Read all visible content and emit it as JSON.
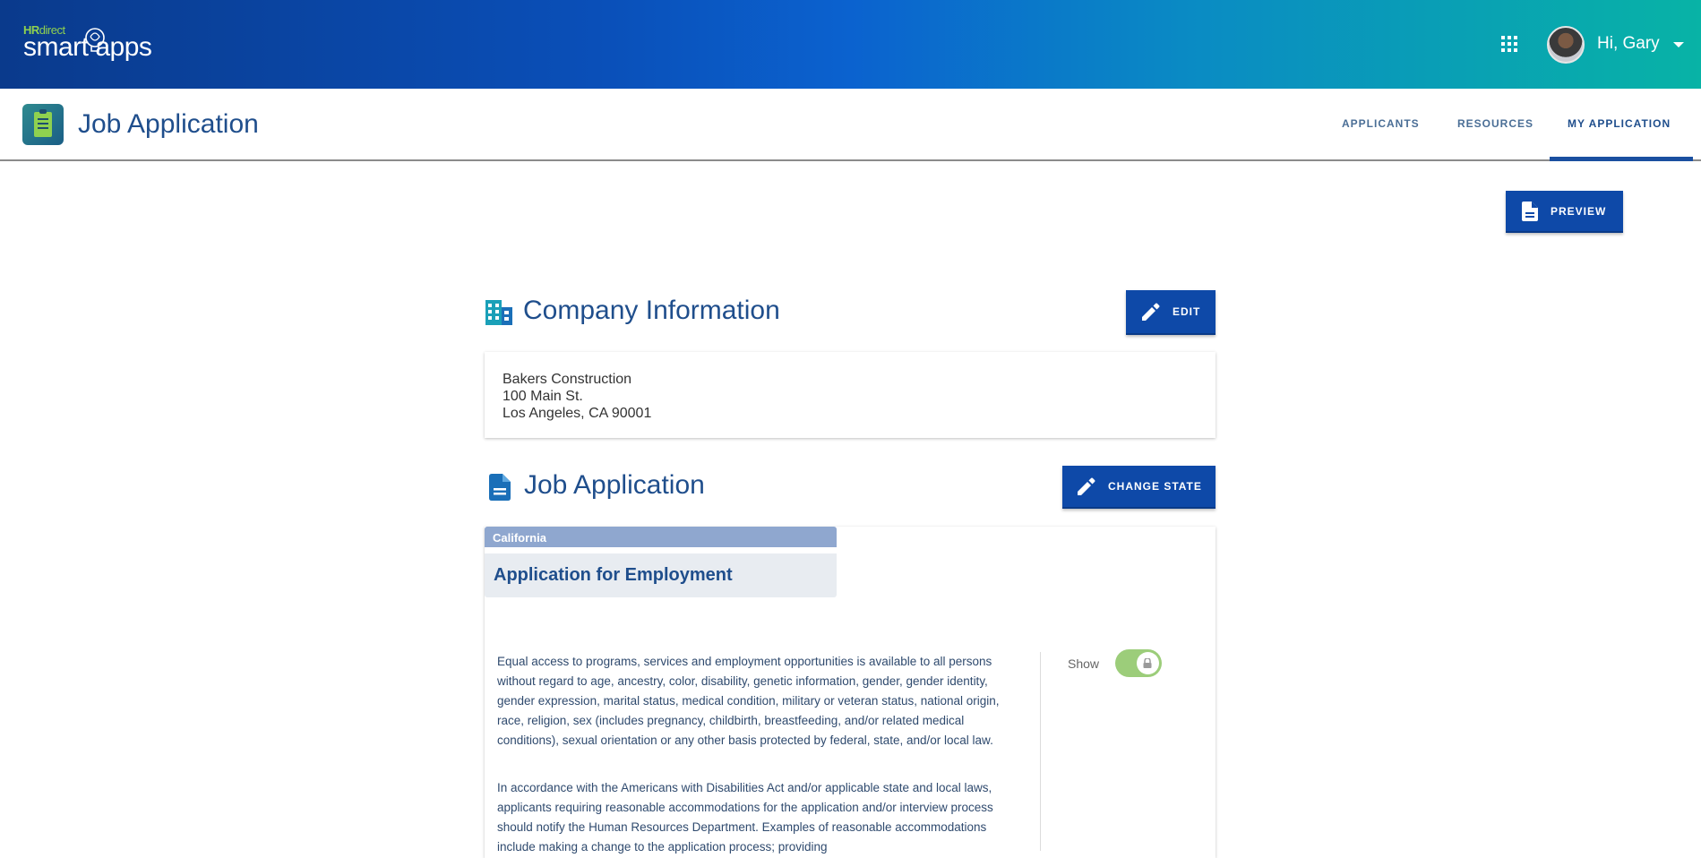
{
  "header": {
    "logo_brand_prefix": "HR",
    "logo_brand_suffix": "direct",
    "logo_product": "smart apps",
    "greeting": "Hi, Gary",
    "colors": {
      "gradient_start": "#0a3a8c",
      "gradient_end": "#08b3a6",
      "logo_accent": "#8fd14f"
    }
  },
  "appbar": {
    "title": "Job Application",
    "nav": [
      {
        "label": "APPLICANTS"
      },
      {
        "label": "RESOURCES"
      },
      {
        "label": "MY APPLICATION",
        "active": true
      }
    ]
  },
  "actions": {
    "preview_label": "PREVIEW"
  },
  "company": {
    "heading": "Company Information",
    "edit_label": "EDIT",
    "name": "Bakers Construction",
    "street": "100 Main St.",
    "city_state_zip": "Los Angeles, CA 90001"
  },
  "job_application": {
    "heading": "Job Application",
    "change_state_label": "CHANGE STATE",
    "state": "California",
    "form_title": "Application for Employment",
    "paragraphs": [
      "Equal access to programs, services and employment opportunities is available to all persons without regard to age, ancestry, color, disability, genetic information, gender, gender identity, gender expression, marital status, medical condition, military or veteran status, national origin, race, religion, sex (includes pregnancy, childbirth, breastfeeding, and/or related medical conditions), sexual orientation or any other basis protected by federal, state, and/or local law.",
      "In accordance with the Americans with Disabilities Act and/or applicable state and local laws, applicants requiring reasonable accommodations for the application and/or interview process should notify the Human Resources Department. Examples of reasonable accommodations include making a change to the application process; providing"
    ],
    "show_label": "Show",
    "show_toggle_on": true
  },
  "icons": {
    "apps": "grid-icon",
    "company": "building-icon",
    "document": "document-icon",
    "edit": "pencil-icon",
    "lock": "lock-icon"
  }
}
